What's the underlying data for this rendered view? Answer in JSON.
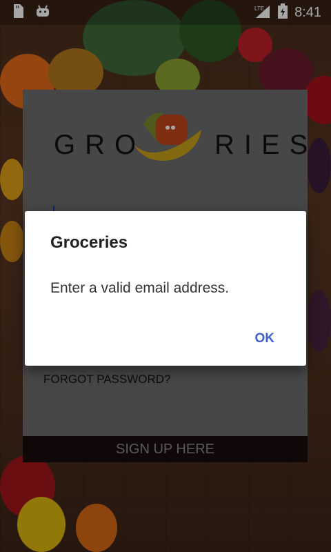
{
  "status_bar": {
    "time": "8:41",
    "network": "LTE",
    "icons": [
      "sd-card-icon",
      "android-icon",
      "signal-icon",
      "battery-icon"
    ]
  },
  "login": {
    "logo_text_left": "GRO",
    "logo_text_right": "RIES",
    "forgot_password": "FORGOT PASSWORD?",
    "sign_up": "SIGN UP HERE"
  },
  "dialog": {
    "title": "Groceries",
    "message": "Enter a valid email address.",
    "ok_label": "OK"
  },
  "colors": {
    "accent": "#3f5fd0",
    "signup_bar": "#1a0c0e",
    "card": "#6d6d6d"
  }
}
